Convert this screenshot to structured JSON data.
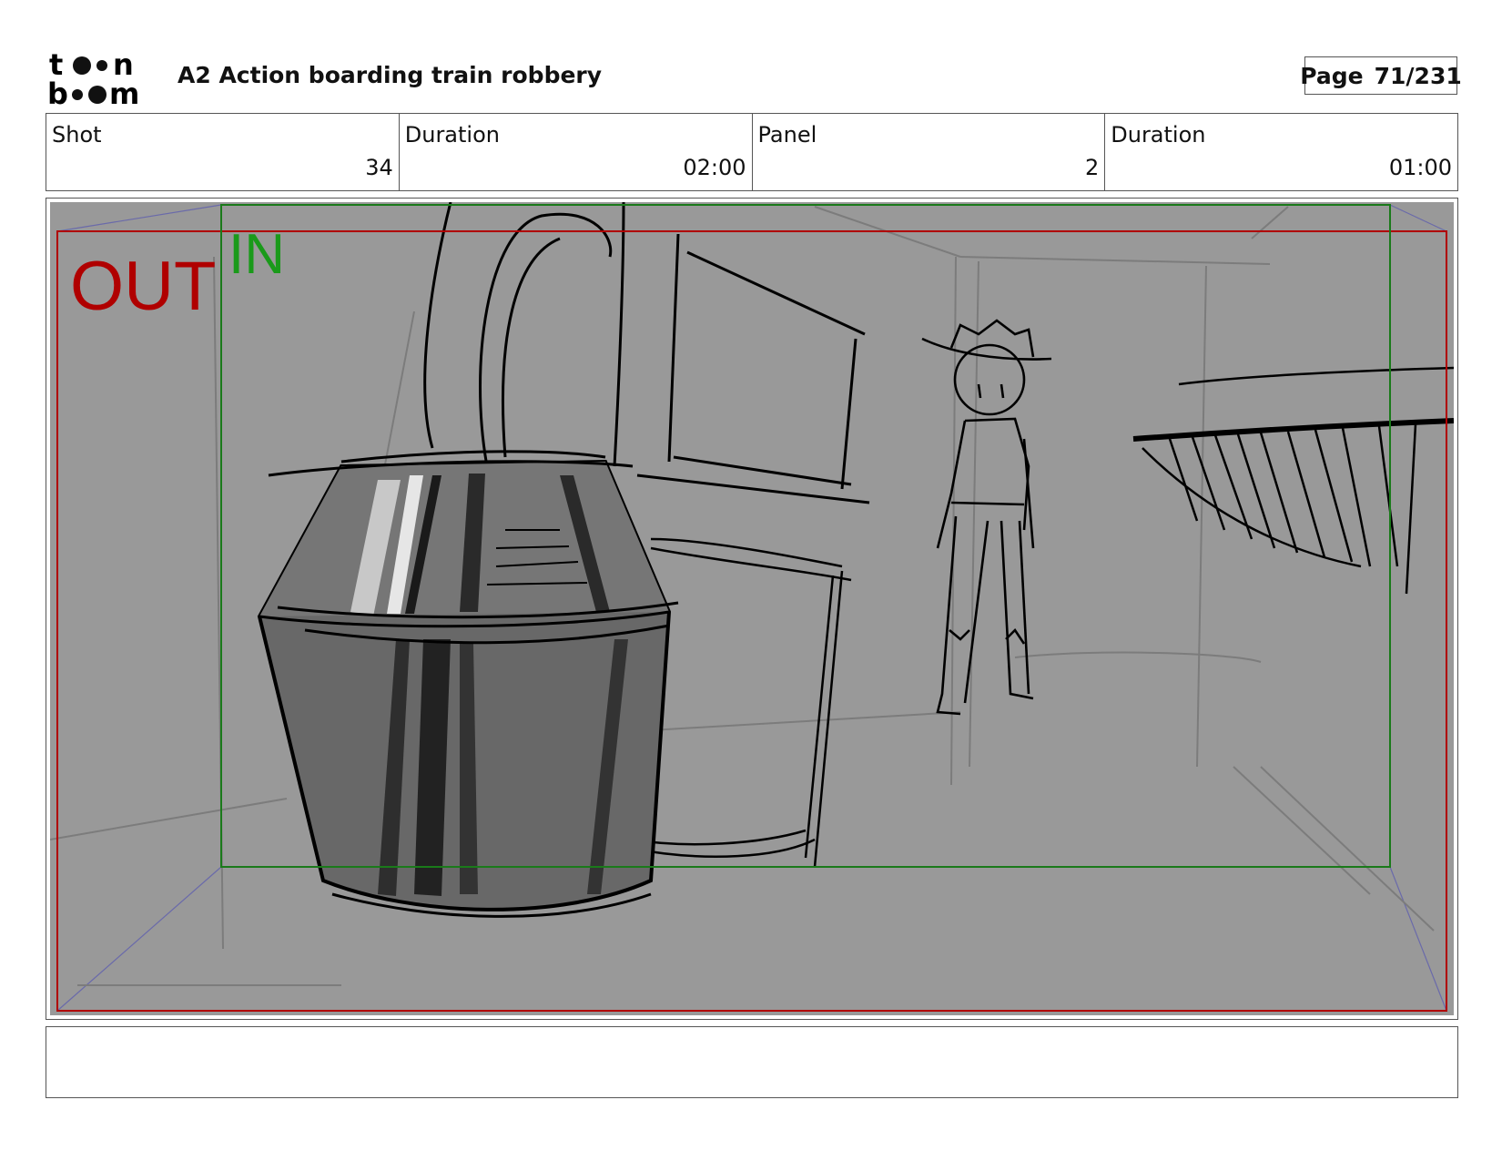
{
  "header": {
    "logo_text": "toon boom",
    "title": "A2 Action boarding train robbery",
    "page_label": "Page",
    "page_number": "71/231"
  },
  "info": {
    "shot_label": "Shot",
    "shot_value": "34",
    "shot_duration_label": "Duration",
    "shot_duration_value": "02:00",
    "panel_label": "Panel",
    "panel_value": "2",
    "panel_duration_label": "Duration",
    "panel_duration_value": "01:00"
  },
  "frame": {
    "out_label": "OUT",
    "in_label": "IN",
    "out_color": "#b00000",
    "in_color": "#1a9a1a",
    "sketch_background": "#999999"
  },
  "notes": {
    "text": ""
  }
}
